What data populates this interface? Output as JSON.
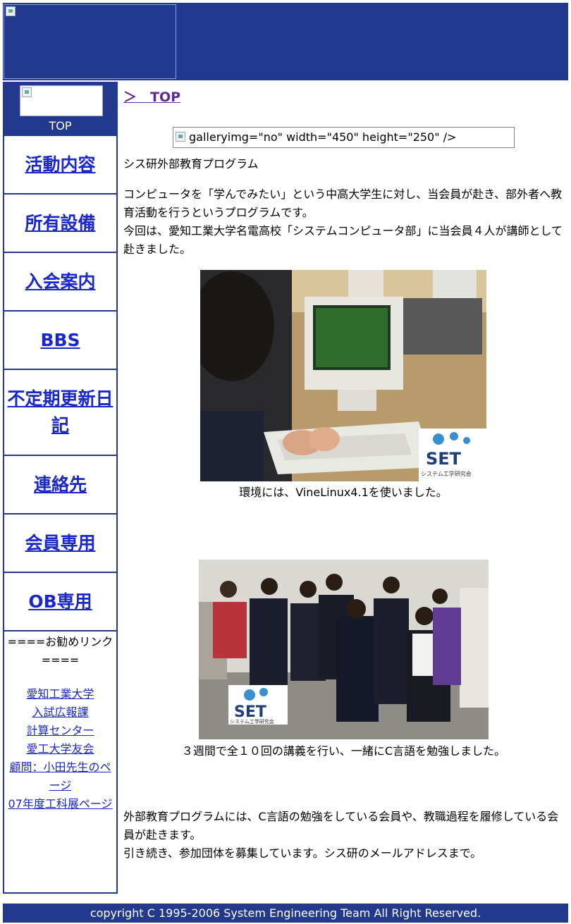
{
  "sidebar": {
    "top_label": "TOP",
    "nav": [
      {
        "label": "活動内容"
      },
      {
        "label": "所有設備"
      },
      {
        "label": "入会案内"
      },
      {
        "label": "BBS"
      },
      {
        "label": "不定期更新日記"
      },
      {
        "label": "連絡先"
      },
      {
        "label": "会員専用"
      },
      {
        "label": "OB専用"
      }
    ],
    "links_heading": "====お勧めリンク====",
    "links": [
      "愛知工業大学",
      "入試広報課",
      "計算センター",
      "愛工大学友会",
      "顧問：小田先生のページ",
      "07年度工科展ページ"
    ]
  },
  "main": {
    "breadcrumb": "＞　TOP",
    "image_placeholder": "galleryimg=\"no\" width=\"450\" height=\"250\" />",
    "heading": "シス研外部教育プログラム",
    "intro_1": "コンピュータを「学んでみたい」という中高大学生に対し、当会員が赴き、部外者へ教育活動を行うというプログラムです。",
    "intro_2": "今回は、愛知工業大学名電高校「システムコンピュータ部」に当会員４人が講師として赴きました。",
    "caption_1": "環境には、VineLinux4.1を使いました。",
    "caption_2": "３週間で全１０回の講義を行い、一緒にC言語を勉強しました。",
    "outro_1": "外部教育プログラムには、C言語の勉強をしている会員や、教職過程を履修している会員が赴きます。",
    "outro_2": "引き続き、参加団体を募集しています。シス研のメールアドレスまで。",
    "photo_logo_text": "SET",
    "photo_logo_sub": "システム工学研究会"
  },
  "footer": {
    "copyright": "copyright C 1995-2006 System Engineering Team All Right Reserved."
  },
  "colors": {
    "brand_blue": "#22398e",
    "link_blue": "#1a28c8",
    "visited_purple": "#5e2a8e"
  }
}
